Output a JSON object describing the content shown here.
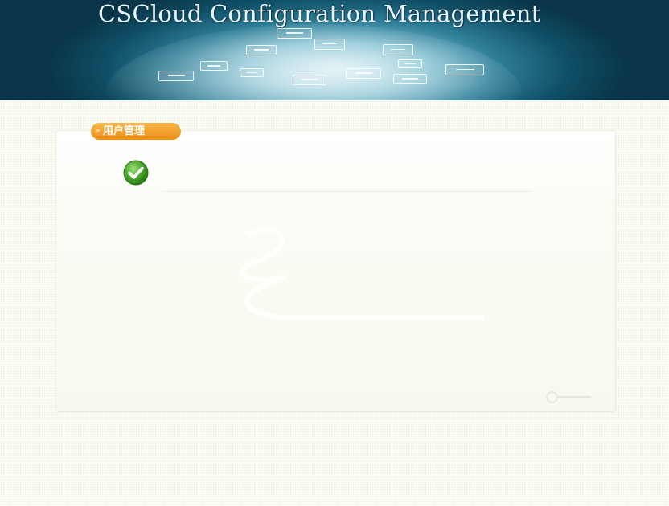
{
  "header": {
    "title": "CSCloud Configuration Management"
  },
  "panel": {
    "tab_label": "用户管理",
    "tab_arrow": "»",
    "message_icon": "success-check-icon",
    "message": ""
  },
  "colors": {
    "accent": "#ec8f17",
    "success": "#46a32a",
    "header": "#0f4f66"
  }
}
